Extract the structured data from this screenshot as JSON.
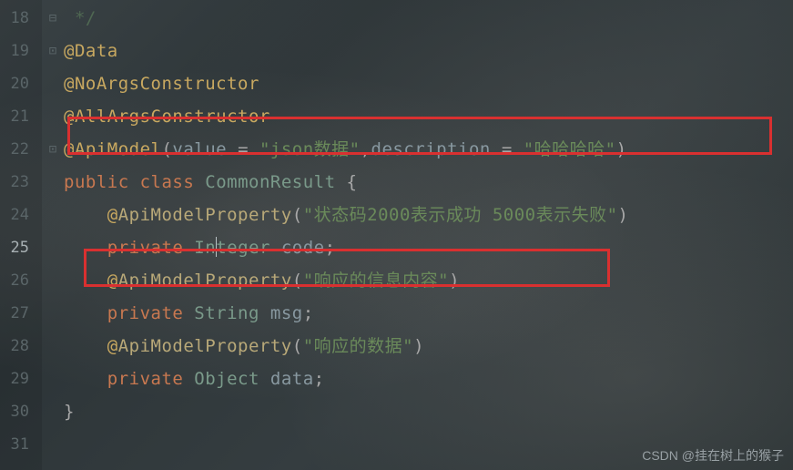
{
  "gutter": {
    "lines": [
      "18",
      "19",
      "20",
      "21",
      "22",
      "23",
      "24",
      "25",
      "26",
      "27",
      "28",
      "29",
      "30",
      "31"
    ],
    "current": "25"
  },
  "fold": {
    "marks": {
      "0": "⊟",
      "1": "⊡",
      "4": "⊡"
    }
  },
  "code": {
    "l18": {
      "comment": "*/"
    },
    "l19": {
      "at": "@",
      "ann": "Data"
    },
    "l20": {
      "at": "@",
      "ann": "NoArgsConstructor"
    },
    "l21": {
      "at": "@",
      "ann": "AllArgsConstructor"
    },
    "l22": {
      "at": "@",
      "ann": "ApiModel",
      "lp": "(",
      "p1": "value",
      "eq1": " = ",
      "s1": "\"json数据\"",
      "comma": ",",
      "p2": "description",
      "eq2": " = ",
      "s2": "\"哈哈哈哈\"",
      "rp": ")"
    },
    "l23": {
      "kw1": "public",
      "kw2": "class",
      "name": "CommonResult",
      "brace": "{"
    },
    "l24": {
      "at": "@",
      "ann": "ApiModelProperty",
      "lp": "(",
      "s": "\"状态码2000表示成功 5000表示失败\"",
      "rp": ")"
    },
    "l25": {
      "kw": "private",
      "type_a": "In",
      "type_b": "teger",
      "id": "code",
      "semi": ";"
    },
    "l26": {
      "at": "@",
      "ann": "ApiModelProperty",
      "lp": "(",
      "s": "\"响应的信息内容\"",
      "rp": ")"
    },
    "l27": {
      "kw": "private",
      "type": "String",
      "id": "msg",
      "semi": ";"
    },
    "l28": {
      "at": "@",
      "ann": "ApiModelProperty",
      "lp": "(",
      "s": "\"响应的数据\"",
      "rp": ")"
    },
    "l29": {
      "kw": "private",
      "type": "Object",
      "id": "data",
      "semi": ";"
    },
    "l30": {
      "brace": "}"
    }
  },
  "watermark": "CSDN @挂在树上的猴子"
}
